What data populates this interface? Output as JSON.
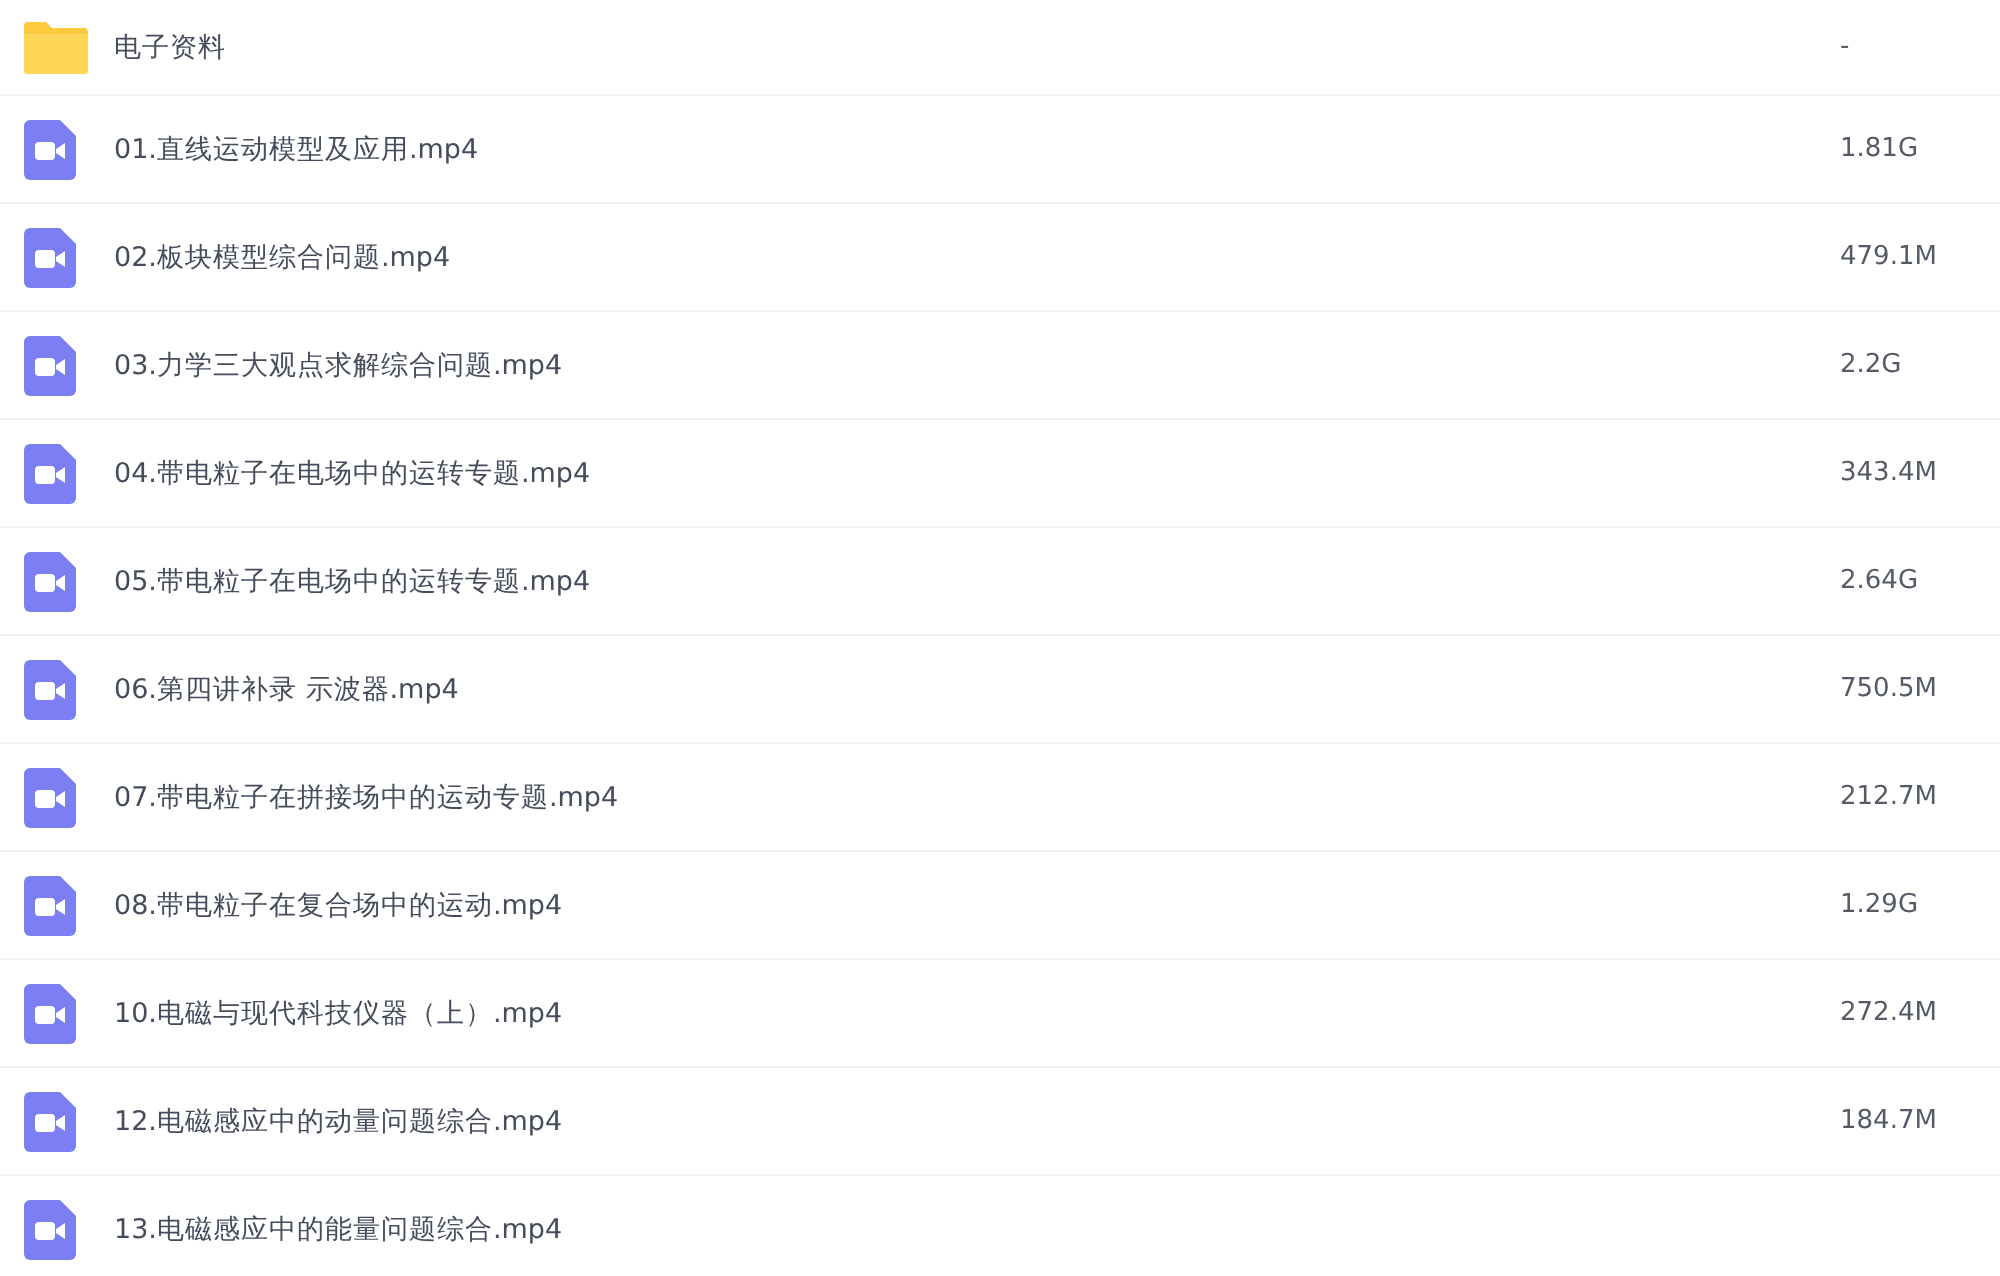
{
  "files": [
    {
      "kind": "folder",
      "name": "电子资料",
      "size": "-"
    },
    {
      "kind": "video",
      "name": "01.直线运动模型及应用.mp4",
      "size": "1.81G"
    },
    {
      "kind": "video",
      "name": "02.板块模型综合问题.mp4",
      "size": "479.1M"
    },
    {
      "kind": "video",
      "name": "03.力学三大观点求解综合问题.mp4",
      "size": "2.2G"
    },
    {
      "kind": "video",
      "name": "04.带电粒子在电场中的运转专题.mp4",
      "size": "343.4M"
    },
    {
      "kind": "video",
      "name": "05.带电粒子在电场中的运转专题.mp4",
      "size": "2.64G"
    },
    {
      "kind": "video",
      "name": "06.第四讲补录 示波器.mp4",
      "size": "750.5M"
    },
    {
      "kind": "video",
      "name": "07.带电粒子在拼接场中的运动专题.mp4",
      "size": "212.7M"
    },
    {
      "kind": "video",
      "name": "08.带电粒子在复合场中的运动.mp4",
      "size": "1.29G"
    },
    {
      "kind": "video",
      "name": "10.电磁与现代科技仪器（上）.mp4",
      "size": "272.4M"
    },
    {
      "kind": "video",
      "name": "12.电磁感应中的动量问题综合.mp4",
      "size": "184.7M"
    },
    {
      "kind": "video",
      "name": "13.电磁感应中的能量问题综合.mp4"
    }
  ]
}
